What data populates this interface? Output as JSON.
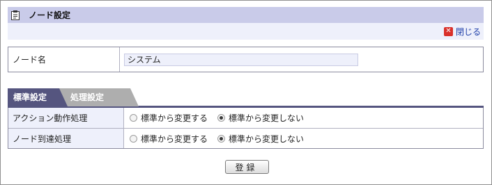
{
  "header": {
    "title": "ノード設定",
    "close_label": "閉じる"
  },
  "node": {
    "label": "ノード名",
    "value": "システム"
  },
  "tabs": [
    {
      "label": "標準設定",
      "active": true
    },
    {
      "label": "処理設定",
      "active": false
    }
  ],
  "settings": [
    {
      "label": "アクション動作処理",
      "options": [
        {
          "label": "標準から変更する",
          "selected": false
        },
        {
          "label": "標準から変更しない",
          "selected": true
        }
      ]
    },
    {
      "label": "ノード到達処理",
      "options": [
        {
          "label": "標準から変更する",
          "selected": false
        },
        {
          "label": "標準から変更しない",
          "selected": true
        }
      ]
    }
  ],
  "register_label": "登録",
  "colors": {
    "header_bg": "#c9cbe9",
    "subbar_bg": "#eef0fb",
    "active_tab": "#55557f",
    "inactive_tab": "#aeaeae",
    "close_icon": "#d9302a"
  }
}
